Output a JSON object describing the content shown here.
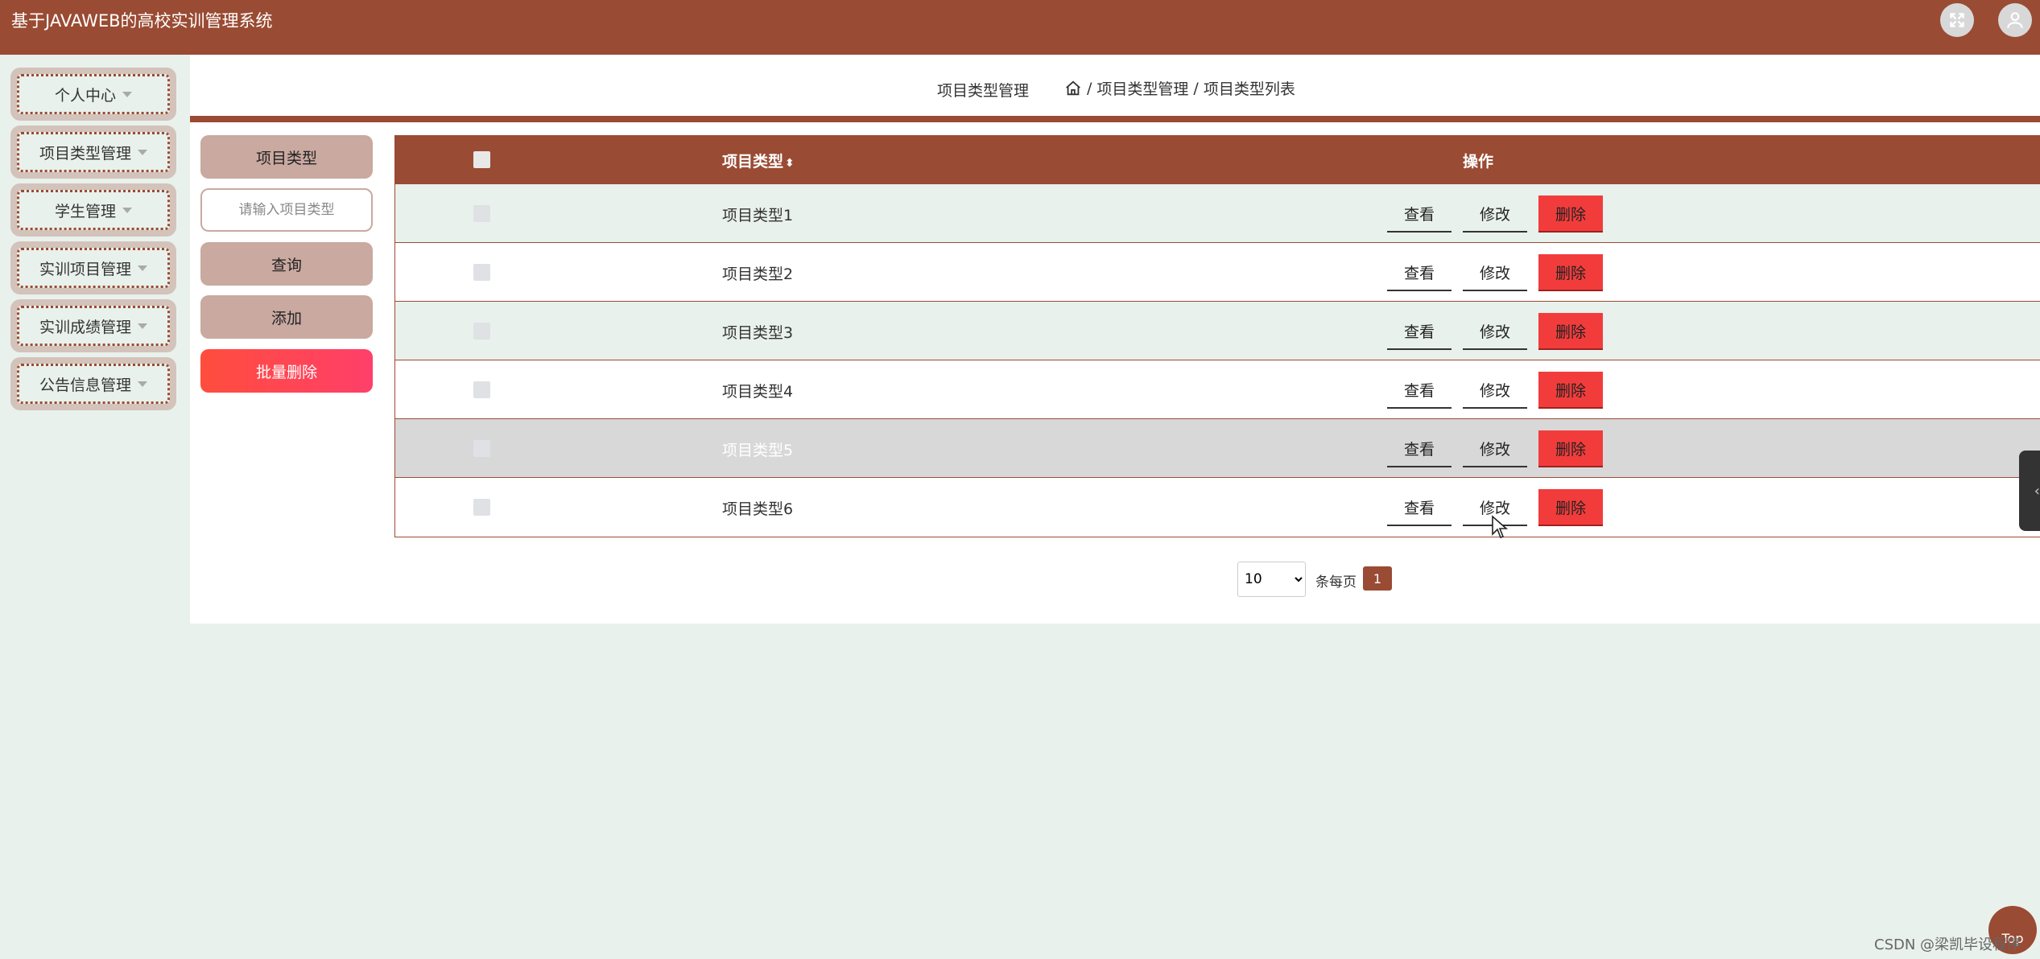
{
  "app": {
    "title": "基于JAVAWEB的高校实训管理系统"
  },
  "header": {
    "fullscreen_icon": "fullscreen-icon",
    "user_icon": "user-icon"
  },
  "sidebar": {
    "items": [
      {
        "label": "个人中心"
      },
      {
        "label": "项目类型管理"
      },
      {
        "label": "学生管理"
      },
      {
        "label": "实训项目管理"
      },
      {
        "label": "实训成绩管理"
      },
      {
        "label": "公告信息管理"
      }
    ]
  },
  "breadcrumb": {
    "title": "项目类型管理",
    "sep": "/",
    "level1": "项目类型管理",
    "level2": "项目类型列表",
    "home_icon": "home-icon"
  },
  "search": {
    "field_label": "项目类型",
    "placeholder": "请输入项目类型",
    "query_label": "查询",
    "add_label": "添加",
    "batch_delete_label": "批量删除"
  },
  "table": {
    "headers": {
      "name": "项目类型",
      "sort_symbol": "⬍",
      "ops": "操作"
    },
    "actions": {
      "view": "查看",
      "edit": "修改",
      "delete": "删除"
    },
    "rows": [
      {
        "name": "项目类型1"
      },
      {
        "name": "项目类型2"
      },
      {
        "name": "项目类型3"
      },
      {
        "name": "项目类型4"
      },
      {
        "name": "项目类型5"
      },
      {
        "name": "项目类型6"
      }
    ]
  },
  "pagination": {
    "page_size": "10",
    "per_page_label": "条每页",
    "current_page": "1"
  },
  "misc": {
    "top_label": "Top",
    "watermark": "CSDN @梁凯毕设程序"
  },
  "colors": {
    "primary": "#9a4b33",
    "danger": "#f23c3c",
    "bg": "#e9f1ec"
  }
}
